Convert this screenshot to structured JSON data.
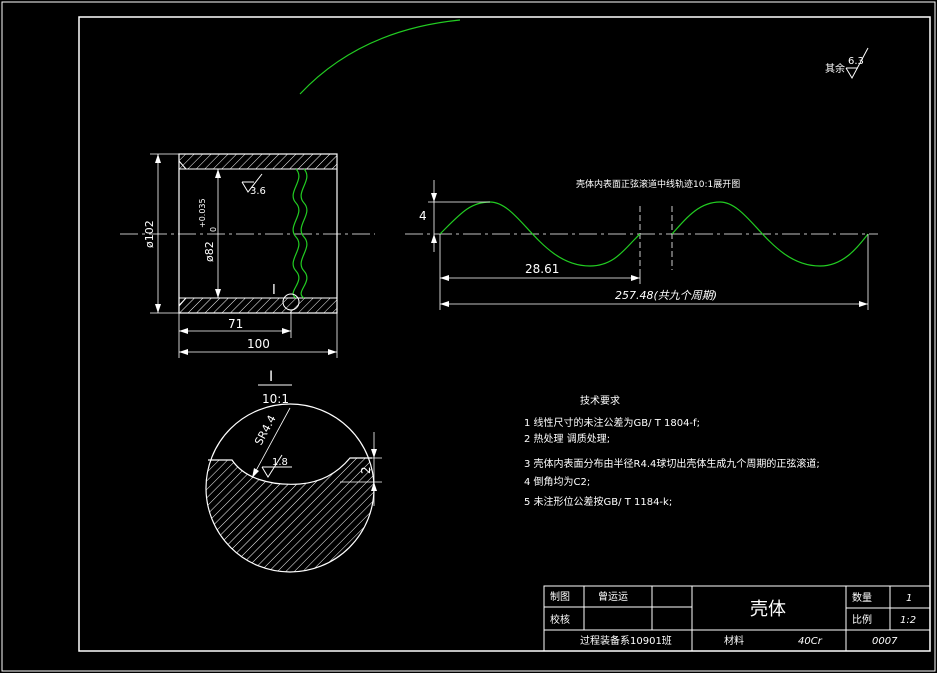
{
  "colors": {
    "background": "#000000",
    "line": "#ffffff",
    "curve": "#22cc22",
    "hatch": "#ffffff",
    "centerline": "#ffffff"
  },
  "roughness": {
    "label": "其余",
    "value": "6.3"
  },
  "section_view": {
    "outer_diameter": "ø102",
    "inner_diameter": "ø82",
    "tolerance_upper": "+0.035",
    "tolerance_lower": "0",
    "length_71": "71",
    "length_100": "100",
    "roughness_value": "3.6",
    "detail_marker": "I"
  },
  "wave_view": {
    "title": "壳体内表面正弦滚道中线轨迹10:1展开图",
    "amplitude": "4",
    "period_length": "28.61",
    "total_length": "257.48(共九个周期)"
  },
  "detail_view": {
    "label": "I",
    "scale": "10:1",
    "radius": "SR4.4",
    "roughness_value": "1.8",
    "depth": "2"
  },
  "tech_requirements": {
    "title": "技术要求",
    "items": [
      "1 线性尺寸的未注公差为GB/ T 1804-f;",
      "2 热处理 调质处理;",
      "3 壳体内表面分布由半径R4.4球切出壳体生成九个周期的正弦滚道;",
      "4 倒角均为C2;",
      "5 未注形位公差按GB/ T 1184-k;"
    ]
  },
  "title_block": {
    "drawn_label": "制图",
    "drawn_name": "曾运运",
    "check_label": "校核",
    "part_name": "壳体",
    "quantity_label": "数量",
    "quantity_value": "1",
    "scale_label": "比例",
    "scale_value": "1:2",
    "class_label": "过程装备系10901班",
    "material_label": "材料",
    "material_value": "40Cr",
    "drawing_number": "0007"
  }
}
